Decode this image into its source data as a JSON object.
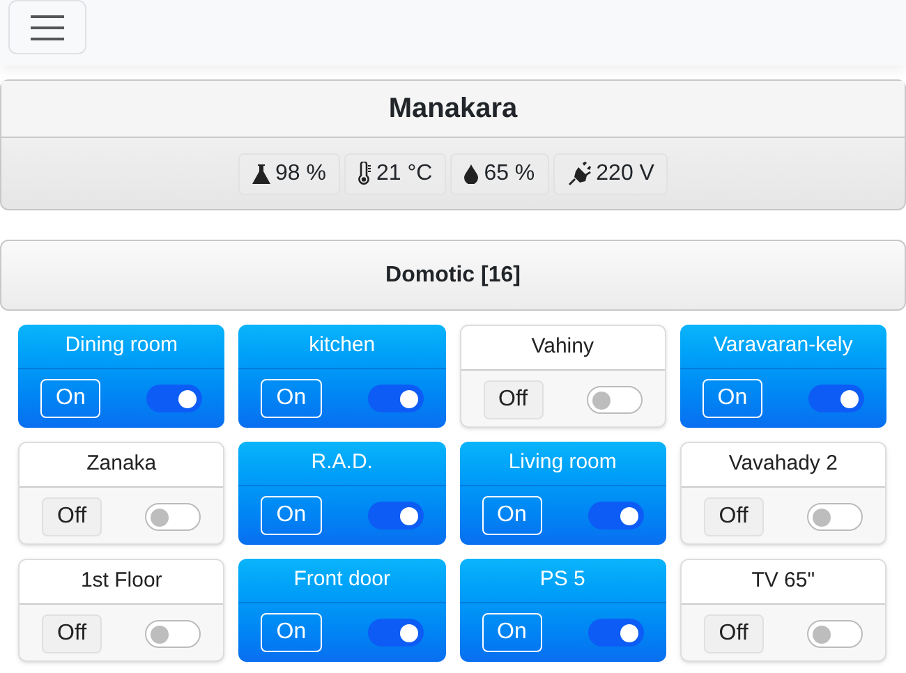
{
  "location": {
    "title": "Manakara",
    "stats": [
      {
        "kind": "flask",
        "value": "98 %"
      },
      {
        "kind": "thermometer",
        "value": "21 °C"
      },
      {
        "kind": "drop",
        "value": "65 %"
      },
      {
        "kind": "plug",
        "value": "220 V"
      }
    ]
  },
  "section": {
    "title": "Domotic [16]"
  },
  "devices": [
    {
      "name": "Dining room",
      "state": "On",
      "on": true
    },
    {
      "name": "kitchen",
      "state": "On",
      "on": true
    },
    {
      "name": "Vahiny",
      "state": "Off",
      "on": false
    },
    {
      "name": "Varavaran-kely",
      "state": "On",
      "on": true
    },
    {
      "name": "Zanaka",
      "state": "Off",
      "on": false
    },
    {
      "name": "R.A.D.",
      "state": "On",
      "on": true
    },
    {
      "name": "Living room",
      "state": "On",
      "on": true
    },
    {
      "name": "Vavahady 2",
      "state": "Off",
      "on": false
    },
    {
      "name": "1st Floor",
      "state": "Off",
      "on": false
    },
    {
      "name": "Front door",
      "state": "On",
      "on": true
    },
    {
      "name": "PS 5",
      "state": "On",
      "on": true
    },
    {
      "name": "TV 65\"",
      "state": "Off",
      "on": false
    }
  ]
}
